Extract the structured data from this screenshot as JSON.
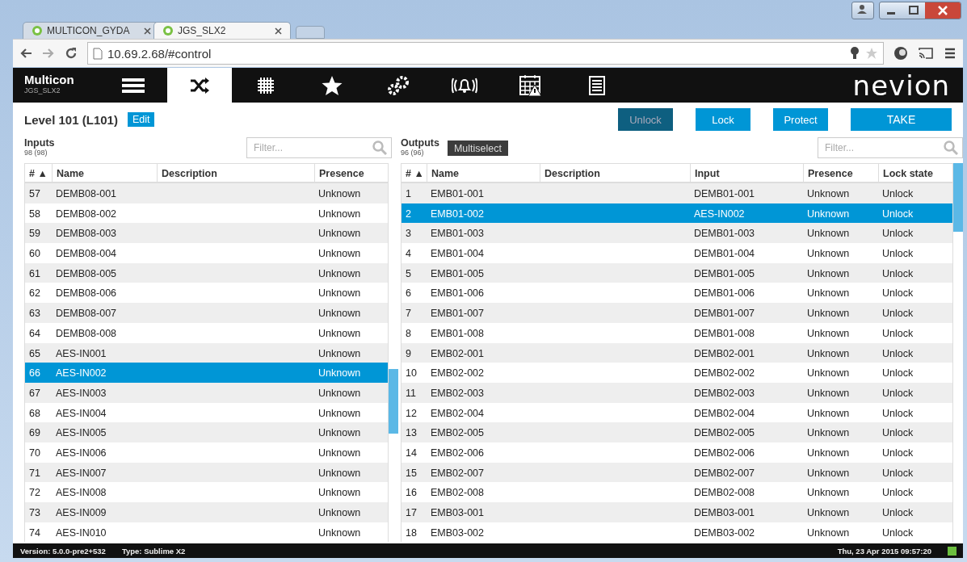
{
  "browser": {
    "tabs": [
      {
        "title": "MULTICON_GYDA",
        "selected": false
      },
      {
        "title": "JGS_SLX2",
        "selected": true
      }
    ],
    "address": "10.69.2.68/#control"
  },
  "app": {
    "name": "Multicon",
    "device": "JGS_SLX2",
    "logo": "nevion",
    "nav": [
      {
        "kind": "rack",
        "selected": false
      },
      {
        "kind": "shuffle",
        "selected": true
      },
      {
        "kind": "grid",
        "selected": false
      },
      {
        "kind": "star",
        "selected": false
      },
      {
        "kind": "gears",
        "selected": false
      },
      {
        "kind": "alarm",
        "selected": false
      },
      {
        "kind": "calendar",
        "selected": false
      },
      {
        "kind": "document",
        "selected": false
      }
    ]
  },
  "level": {
    "title": "Level 101 (L101)",
    "edit": "Edit"
  },
  "actions": [
    {
      "label": "Unlock",
      "disabled": true
    },
    {
      "label": "Lock",
      "disabled": false
    },
    {
      "label": "Protect",
      "disabled": false
    },
    {
      "label": "TAKE",
      "disabled": false
    }
  ],
  "inputs": {
    "title": "Inputs",
    "count": "98 (98)",
    "filter_placeholder": "Filter...",
    "columns": [
      "# ▲",
      "Name",
      "Description",
      "Presence"
    ],
    "rows": [
      {
        "cells": [
          "57",
          "DEMB08-001",
          "",
          "Unknown"
        ],
        "selected": false
      },
      {
        "cells": [
          "58",
          "DEMB08-002",
          "",
          "Unknown"
        ],
        "selected": false
      },
      {
        "cells": [
          "59",
          "DEMB08-003",
          "",
          "Unknown"
        ],
        "selected": false
      },
      {
        "cells": [
          "60",
          "DEMB08-004",
          "",
          "Unknown"
        ],
        "selected": false
      },
      {
        "cells": [
          "61",
          "DEMB08-005",
          "",
          "Unknown"
        ],
        "selected": false
      },
      {
        "cells": [
          "62",
          "DEMB08-006",
          "",
          "Unknown"
        ],
        "selected": false
      },
      {
        "cells": [
          "63",
          "DEMB08-007",
          "",
          "Unknown"
        ],
        "selected": false
      },
      {
        "cells": [
          "64",
          "DEMB08-008",
          "",
          "Unknown"
        ],
        "selected": false
      },
      {
        "cells": [
          "65",
          "AES-IN001",
          "",
          "Unknown"
        ],
        "selected": false
      },
      {
        "cells": [
          "66",
          "AES-IN002",
          "",
          "Unknown"
        ],
        "selected": true
      },
      {
        "cells": [
          "67",
          "AES-IN003",
          "",
          "Unknown"
        ],
        "selected": false
      },
      {
        "cells": [
          "68",
          "AES-IN004",
          "",
          "Unknown"
        ],
        "selected": false
      },
      {
        "cells": [
          "69",
          "AES-IN005",
          "",
          "Unknown"
        ],
        "selected": false
      },
      {
        "cells": [
          "70",
          "AES-IN006",
          "",
          "Unknown"
        ],
        "selected": false
      },
      {
        "cells": [
          "71",
          "AES-IN007",
          "",
          "Unknown"
        ],
        "selected": false
      },
      {
        "cells": [
          "72",
          "AES-IN008",
          "",
          "Unknown"
        ],
        "selected": false
      },
      {
        "cells": [
          "73",
          "AES-IN009",
          "",
          "Unknown"
        ],
        "selected": false
      },
      {
        "cells": [
          "74",
          "AES-IN010",
          "",
          "Unknown"
        ],
        "selected": false
      }
    ]
  },
  "outputs": {
    "title": "Outputs",
    "count": "96 (96)",
    "multiselect": "Multiselect",
    "filter_placeholder": "Filter...",
    "columns": [
      "# ▲",
      "Name",
      "Description",
      "Input",
      "Presence",
      "Lock state"
    ],
    "rows": [
      {
        "cells": [
          "1",
          "EMB01-001",
          "",
          "DEMB01-001",
          "Unknown",
          "Unlock"
        ],
        "selected": false
      },
      {
        "cells": [
          "2",
          "EMB01-002",
          "",
          "AES-IN002",
          "Unknown",
          "Unlock"
        ],
        "selected": true
      },
      {
        "cells": [
          "3",
          "EMB01-003",
          "",
          "DEMB01-003",
          "Unknown",
          "Unlock"
        ],
        "selected": false
      },
      {
        "cells": [
          "4",
          "EMB01-004",
          "",
          "DEMB01-004",
          "Unknown",
          "Unlock"
        ],
        "selected": false
      },
      {
        "cells": [
          "5",
          "EMB01-005",
          "",
          "DEMB01-005",
          "Unknown",
          "Unlock"
        ],
        "selected": false
      },
      {
        "cells": [
          "6",
          "EMB01-006",
          "",
          "DEMB01-006",
          "Unknown",
          "Unlock"
        ],
        "selected": false
      },
      {
        "cells": [
          "7",
          "EMB01-007",
          "",
          "DEMB01-007",
          "Unknown",
          "Unlock"
        ],
        "selected": false
      },
      {
        "cells": [
          "8",
          "EMB01-008",
          "",
          "DEMB01-008",
          "Unknown",
          "Unlock"
        ],
        "selected": false
      },
      {
        "cells": [
          "9",
          "EMB02-001",
          "",
          "DEMB02-001",
          "Unknown",
          "Unlock"
        ],
        "selected": false
      },
      {
        "cells": [
          "10",
          "EMB02-002",
          "",
          "DEMB02-002",
          "Unknown",
          "Unlock"
        ],
        "selected": false
      },
      {
        "cells": [
          "11",
          "EMB02-003",
          "",
          "DEMB02-003",
          "Unknown",
          "Unlock"
        ],
        "selected": false
      },
      {
        "cells": [
          "12",
          "EMB02-004",
          "",
          "DEMB02-004",
          "Unknown",
          "Unlock"
        ],
        "selected": false
      },
      {
        "cells": [
          "13",
          "EMB02-005",
          "",
          "DEMB02-005",
          "Unknown",
          "Unlock"
        ],
        "selected": false
      },
      {
        "cells": [
          "14",
          "EMB02-006",
          "",
          "DEMB02-006",
          "Unknown",
          "Unlock"
        ],
        "selected": false
      },
      {
        "cells": [
          "15",
          "EMB02-007",
          "",
          "DEMB02-007",
          "Unknown",
          "Unlock"
        ],
        "selected": false
      },
      {
        "cells": [
          "16",
          "EMB02-008",
          "",
          "DEMB02-008",
          "Unknown",
          "Unlock"
        ],
        "selected": false
      },
      {
        "cells": [
          "17",
          "EMB03-001",
          "",
          "DEMB03-001",
          "Unknown",
          "Unlock"
        ],
        "selected": false
      },
      {
        "cells": [
          "18",
          "EMB03-002",
          "",
          "DEMB03-002",
          "Unknown",
          "Unlock"
        ],
        "selected": false
      }
    ]
  },
  "status_bar": {
    "version": "Version: 5.0.0-pre2+532",
    "type": "Type: Sublime X2",
    "datetime": "Thu, 23 Apr 2015 09:57:20"
  }
}
